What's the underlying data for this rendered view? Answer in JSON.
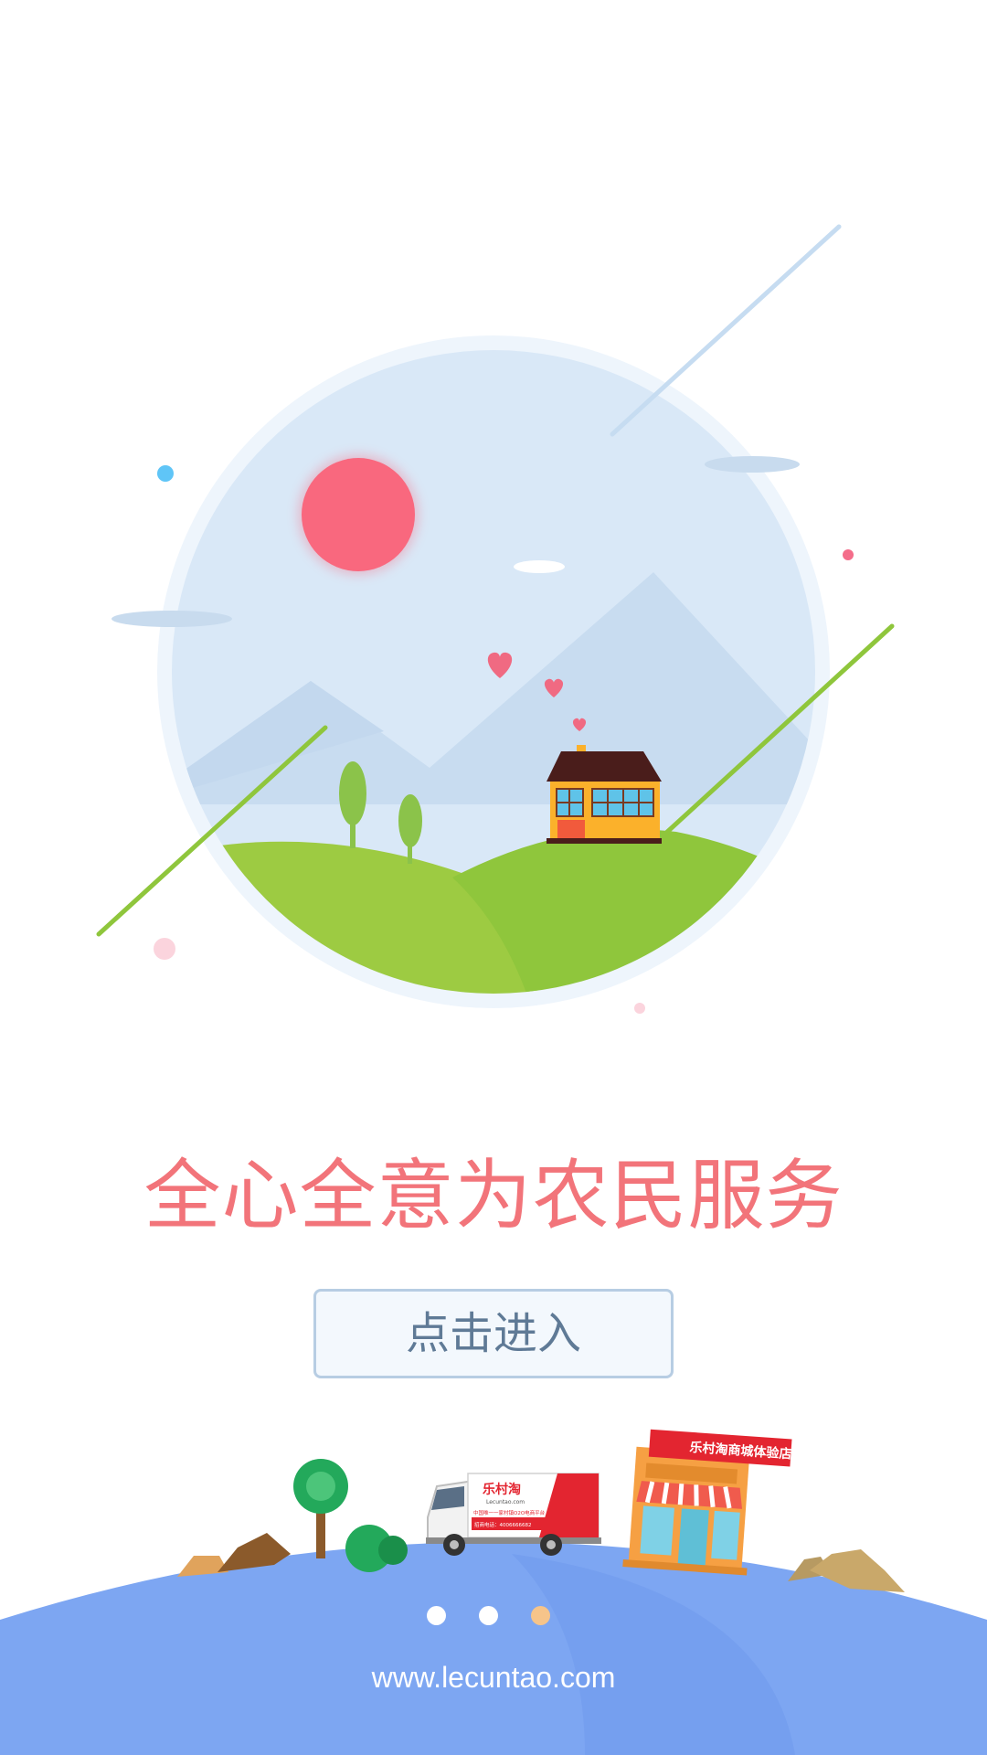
{
  "slogan": "全心全意为农民服务",
  "enter_button": {
    "label": "点击进入"
  },
  "truck": {
    "brand": "乐村淘",
    "domain": "Lecuntao.com",
    "tagline": "中国唯一一家村镇O2O电商平台",
    "phone": "招商电话：4006666682"
  },
  "store": {
    "sign": "乐村淘商城体验店"
  },
  "pagination": {
    "total": 3,
    "current": 3
  },
  "footer": {
    "url": "www.lecuntao.com"
  },
  "colors": {
    "slogan": "#f2747a",
    "button_text": "#5f7a96",
    "sun": "#f9687e",
    "globe": "#7da6f2",
    "dot_inactive": "#ffffff",
    "dot_active": "#f6c48a"
  }
}
